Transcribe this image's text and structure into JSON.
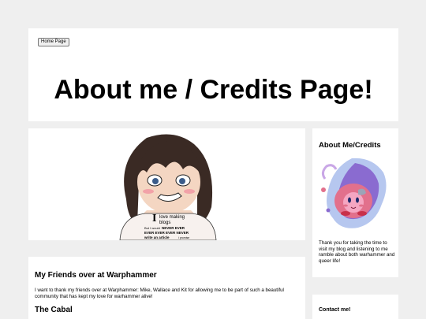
{
  "header": {
    "home_button": "Home Page",
    "title": "About me / Credits Page!"
  },
  "banner": {
    "shirt_letter": "I",
    "shirt_line1": "love making",
    "shirt_line2": "blogs",
    "shirt_line3": "But I would",
    "shirt_line3_bold": "NEVER EVER",
    "shirt_line4": "EVER EVER EVER NEVER",
    "shirt_line5": "write an article",
    "shirt_line5_small": "i promise"
  },
  "post": {
    "heading": "My Friends over at Warphammer",
    "body": "I want to thank my friends over at Warphammer: Mike, Wallace and Kit for allowing me to be part of such a beautiful community that has kept my love for warhammer alive!",
    "subheading": "The Cabal"
  },
  "sidebar": {
    "about_title": "About Me/Credits",
    "about_text": "Thank you for taking the time to visit my blog and listening to me ramble about both warhammer and queer life!",
    "contact_title": "Contact me!"
  },
  "colors": {
    "background": "#efefef",
    "card": "#ffffff",
    "accent_pink": "#e2708c",
    "accent_purple": "#8a6bd0"
  }
}
